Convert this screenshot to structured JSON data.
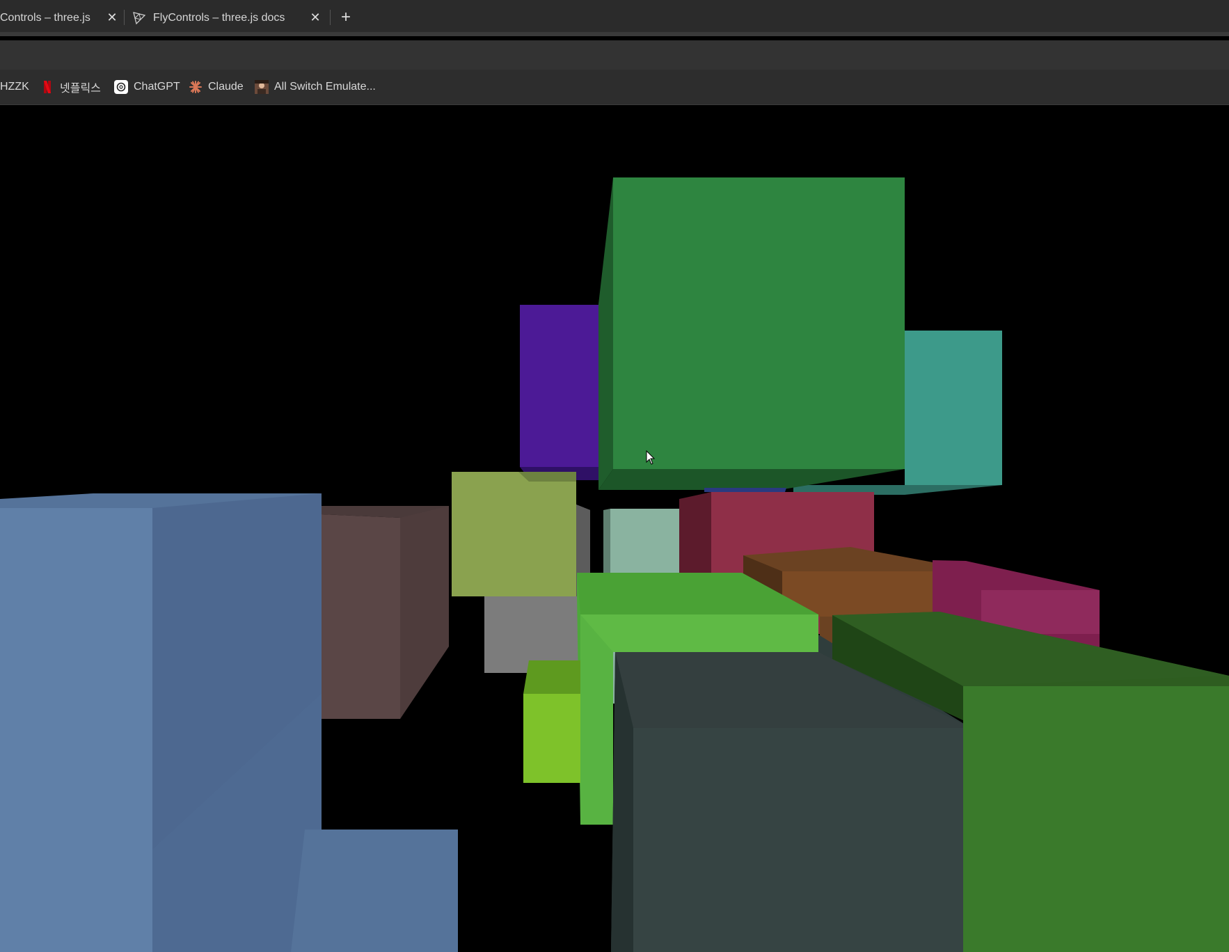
{
  "tabs": [
    {
      "label": "Controls – three.js d",
      "close": "✕"
    },
    {
      "label": "FlyControls – three.js docs",
      "close": "✕"
    }
  ],
  "new_tab": "+",
  "bookmarks": [
    {
      "label": "HZZK",
      "icon": "hzzk-icon"
    },
    {
      "label": "넷플릭스",
      "icon": "netflix-icon"
    },
    {
      "label": "ChatGPT",
      "icon": "chatgpt-icon"
    },
    {
      "label": "Claude",
      "icon": "claude-icon"
    },
    {
      "label": "All Switch Emulate...",
      "icon": "avatar-icon"
    }
  ],
  "scene": {
    "description_colors": {
      "green_cube": "#2e8540",
      "purple_cube": "#4c1a96",
      "teal_cube": "#3d9a8a",
      "olive_cube": "#8aa24f",
      "crimson_cube": "#8f2f48",
      "blue_cube": "#55739a",
      "brown_cube": "#5a4646",
      "gray_cube": "#7a7a7a",
      "lime_cube": "#5fba45",
      "orange_cube": "#7b4a24",
      "magenta_cube": "#7e1f4e",
      "darkgreen_cube": "#346b26",
      "slate_cube": "#2f3d3c"
    }
  }
}
